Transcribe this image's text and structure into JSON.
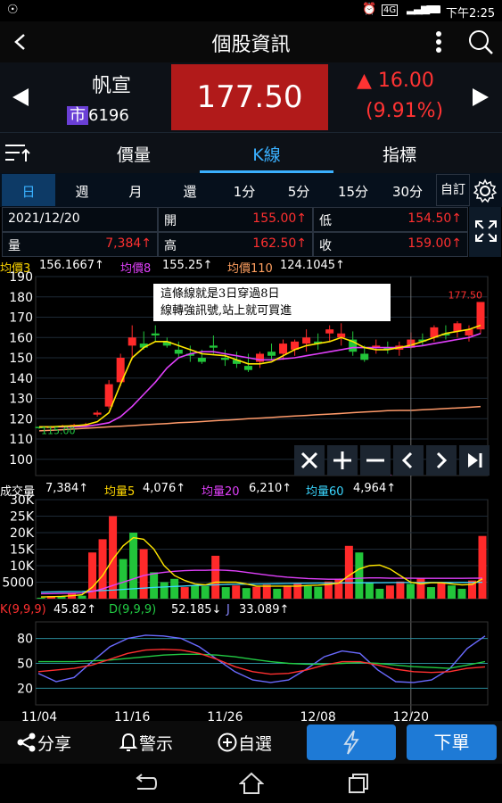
{
  "status": {
    "time": "下午2:25",
    "network": "4G"
  },
  "header": {
    "title": "個股資訊"
  },
  "stock": {
    "name": "帆宣",
    "market_badge": "市",
    "code": "6196",
    "price": "177.50",
    "change": "16.00",
    "change_pct": "(9.91%)",
    "change_color": "#ff3333"
  },
  "tabs": [
    {
      "label": "價量",
      "active": false
    },
    {
      "label": "K線",
      "active": true
    },
    {
      "label": "指標",
      "active": false
    }
  ],
  "periods": [
    "日",
    "週",
    "月",
    "還",
    "1分",
    "5分",
    "15分",
    "30分"
  ],
  "custom_label": "自訂",
  "info": {
    "date": "2021/12/20",
    "open_label": "開",
    "open": "155.00↑",
    "low_label": "低",
    "low": "154.50↑",
    "vol_label": "量",
    "vol": "7,384↑",
    "high_label": "高",
    "high": "162.50↑",
    "close_label": "收",
    "close": "159.00↑"
  },
  "ma_legend": {
    "ma3_label": "均價3",
    "ma3": "156.1667↑",
    "ma8_label": "均價8",
    "ma8": "155.25↑",
    "ma110_label": "均價110",
    "ma110": "124.1045↑"
  },
  "annotation": {
    "line1": "這條線就是3日穿過8日",
    "line2": "線轉強訊號,站上就可買進"
  },
  "volume_legend": {
    "label": "成交量",
    "value": "7,384↑",
    "ma5_label": "均量5",
    "ma5": "4,076↑",
    "ma20_label": "均量20",
    "ma20": "6,210↑",
    "ma60_label": "均量60",
    "ma60": "4,964↑"
  },
  "kd_legend": {
    "k_label": "K(9,9,9)",
    "k": "45.82↑",
    "d_label": "D(9,9,9)",
    "d": "52.185↓",
    "j_label": "J",
    "j": "33.089↑"
  },
  "chart_controls": [
    "close-icon",
    "zoom-in-icon",
    "zoom-out-icon",
    "prev-icon",
    "next-icon",
    "last-icon"
  ],
  "bottom": {
    "share": "分享",
    "alert": "警示",
    "watch": "自選",
    "order": "下單"
  },
  "chart_data": [
    {
      "type": "candlestick",
      "y_ticks": [
        190,
        180,
        170,
        160,
        150,
        140,
        130,
        120,
        110,
        100
      ],
      "ylim": [
        92,
        190
      ],
      "x_ticks": [
        "11/04",
        "11/16",
        "11/26",
        "12/08",
        "12/20"
      ],
      "x_tick_index": [
        0,
        8,
        16,
        24,
        32
      ],
      "last_price_label": "177.50",
      "low_label": "115.00",
      "candles": [
        [
          116,
          116,
          115,
          115.5
        ],
        [
          115.5,
          116.5,
          115,
          116
        ],
        [
          116,
          117,
          115.5,
          116.5
        ],
        [
          116.5,
          117.5,
          116,
          117
        ],
        [
          117,
          118,
          116.5,
          117
        ],
        [
          122,
          124,
          121,
          123
        ],
        [
          126,
          139,
          125,
          137
        ],
        [
          138,
          152,
          136,
          150
        ],
        [
          156,
          166,
          149,
          160
        ],
        [
          157,
          163,
          154,
          155
        ],
        [
          162,
          166,
          158,
          161
        ],
        [
          158,
          160,
          155,
          156
        ],
        [
          154,
          158,
          150,
          152
        ],
        [
          152,
          156,
          148,
          151
        ],
        [
          150,
          154,
          147,
          148
        ],
        [
          156,
          161,
          152,
          155
        ],
        [
          150,
          154,
          146,
          149
        ],
        [
          149,
          153,
          145,
          147
        ],
        [
          146,
          152,
          143,
          144
        ],
        [
          148,
          153,
          145,
          152
        ],
        [
          153,
          157,
          149,
          151
        ],
        [
          152,
          159,
          149,
          157
        ],
        [
          154,
          159,
          151,
          158
        ],
        [
          157,
          164,
          153,
          160
        ],
        [
          158,
          162,
          154,
          157
        ],
        [
          162,
          166,
          158,
          164
        ],
        [
          160,
          167,
          156,
          162
        ],
        [
          159,
          163,
          151,
          153
        ],
        [
          152,
          156,
          148,
          149
        ],
        [
          155,
          159,
          152,
          156
        ],
        [
          155,
          158,
          152,
          154
        ],
        [
          154,
          158,
          151,
          156
        ],
        [
          155,
          162.5,
          154.5,
          159
        ],
        [
          159,
          162,
          156,
          158
        ],
        [
          160,
          166,
          158,
          165
        ],
        [
          162,
          166,
          159,
          161
        ],
        [
          163,
          168,
          160,
          167
        ],
        [
          161,
          166,
          158,
          164
        ],
        [
          164,
          177.5,
          162,
          177.5
        ]
      ],
      "ma3": [
        116,
        116,
        116.3,
        116.5,
        117,
        118.5,
        123,
        137,
        150,
        155,
        158,
        158,
        156,
        154,
        152,
        151.5,
        151,
        149,
        147,
        147,
        148,
        151,
        154,
        156,
        157,
        158,
        160,
        158,
        155,
        154,
        154,
        155,
        156.2,
        158,
        160,
        162,
        163,
        164,
        166
      ],
      "ma8": [
        116,
        116,
        116,
        116,
        116.2,
        117,
        118,
        121,
        126,
        132,
        138,
        145,
        150,
        152,
        153,
        153,
        152,
        151,
        150,
        149,
        149,
        149.5,
        150,
        151,
        152,
        153,
        154,
        155,
        155,
        155,
        155,
        155,
        155.3,
        156,
        157,
        158,
        159,
        160,
        162
      ],
      "ma110": [
        114,
        114.3,
        114.6,
        115,
        115.3,
        115.6,
        116,
        116.3,
        116.6,
        117,
        117.3,
        117.6,
        118,
        118.3,
        118.6,
        119,
        119.3,
        119.6,
        120,
        120.3,
        120.6,
        121,
        121.3,
        121.6,
        122,
        122.3,
        122.6,
        123,
        123.3,
        123.6,
        124,
        124.1,
        124.1,
        124.4,
        124.7,
        125,
        125.3,
        125.6,
        126
      ]
    },
    {
      "type": "bar",
      "title": "成交量",
      "y_ticks": [
        "30K",
        "25K",
        "20K",
        "15K",
        "10K",
        "5000"
      ],
      "y_tick_values": [
        30000,
        25000,
        20000,
        15000,
        10000,
        5000
      ],
      "ylim": [
        0,
        30000
      ],
      "volumes": [
        300,
        800,
        600,
        1500,
        900,
        14000,
        18000,
        25000,
        12000,
        20000,
        15000,
        8000,
        5000,
        6000,
        3500,
        4000,
        3800,
        13000,
        3500,
        4000,
        3200,
        3600,
        4200,
        3000,
        4000,
        4500,
        3800,
        3600,
        5200,
        6000,
        16000,
        14000,
        5000,
        3000,
        4000,
        5200,
        4500,
        6200,
        3500,
        4800,
        4000,
        3000,
        5500,
        19000
      ],
      "volume_up": [
        false,
        true,
        false,
        true,
        false,
        true,
        true,
        true,
        false,
        false,
        true,
        false,
        false,
        false,
        true,
        false,
        false,
        true,
        false,
        true,
        false,
        true,
        true,
        false,
        true,
        true,
        false,
        false,
        true,
        true,
        true,
        false,
        false,
        false,
        true,
        true,
        false,
        true,
        false,
        true,
        false,
        false,
        true,
        true
      ],
      "ma5_vol": [
        500,
        600,
        700,
        900,
        1200,
        3500,
        7000,
        12000,
        16000,
        18500,
        18000,
        15000,
        10000,
        7000,
        5500,
        4500,
        4200,
        5000,
        5000,
        5000,
        4500,
        3800,
        3800,
        3800,
        3800,
        3800,
        4000,
        4100,
        4300,
        4700,
        7000,
        9000,
        10000,
        10200,
        9000,
        7000,
        5000,
        4500,
        4800,
        4800,
        4500,
        4200,
        4300,
        6000
      ],
      "ma20_vol": [
        1500,
        1550,
        1600,
        1650,
        1700,
        2200,
        3000,
        4000,
        5000,
        6000,
        7000,
        7600,
        8000,
        8300,
        8500,
        8600,
        8600,
        8700,
        8600,
        8400,
        8000,
        7600,
        7200,
        6800,
        6500,
        6300,
        6100,
        6000,
        5900,
        5900,
        6000,
        6200,
        6300,
        6300,
        6200,
        6200,
        6200,
        6150,
        6150,
        6150,
        6150,
        6170,
        6180,
        6210
      ],
      "ma60_vol": [
        2000,
        2050,
        2100,
        2150,
        2200,
        2300,
        2450,
        2600,
        2800,
        3000,
        3200,
        3400,
        3550,
        3700,
        3850,
        4000,
        4100,
        4200,
        4300,
        4350,
        4400,
        4450,
        4500,
        4550,
        4600,
        4650,
        4700,
        4720,
        4740,
        4760,
        4780,
        4800,
        4820,
        4840,
        4860,
        4880,
        4890,
        4900,
        4910,
        4920,
        4930,
        4940,
        4950,
        4964
      ]
    },
    {
      "type": "line",
      "title": "KD",
      "y_ticks": [
        80,
        50,
        20
      ],
      "ylim": [
        0,
        100
      ],
      "k": [
        40,
        42,
        44,
        48,
        55,
        62,
        66,
        67,
        66,
        62,
        55,
        46,
        40,
        37,
        38,
        42,
        48,
        52,
        52,
        48,
        43,
        40,
        39,
        40,
        44,
        45.82
      ],
      "d": [
        52,
        52,
        52,
        53,
        54,
        56,
        58,
        60,
        61,
        61,
        60,
        58,
        55,
        52,
        50,
        49,
        49,
        50,
        51,
        50,
        48,
        46,
        45,
        44,
        48,
        52.185
      ],
      "j": [
        38,
        28,
        33,
        52,
        70,
        80,
        84,
        83,
        80,
        70,
        55,
        40,
        30,
        27,
        30,
        43,
        58,
        65,
        62,
        42,
        28,
        27,
        30,
        43,
        68,
        83
      ]
    }
  ]
}
